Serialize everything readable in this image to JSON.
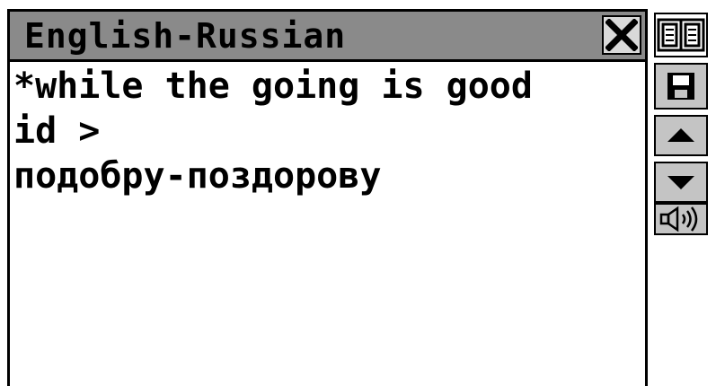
{
  "window": {
    "title": "English-Russian"
  },
  "entry": {
    "headword": "*while the going is good",
    "label": "id >",
    "translation": "подобру-поздорову"
  },
  "toolbar": {
    "icons": [
      "book-icon",
      "save-icon",
      "scroll-up-icon",
      "scroll-down-icon",
      "speaker-icon"
    ]
  },
  "colors": {
    "titlebar": "#8a8a8a",
    "button": "#c4c4c4",
    "text": "#000000",
    "background": "#ffffff"
  }
}
